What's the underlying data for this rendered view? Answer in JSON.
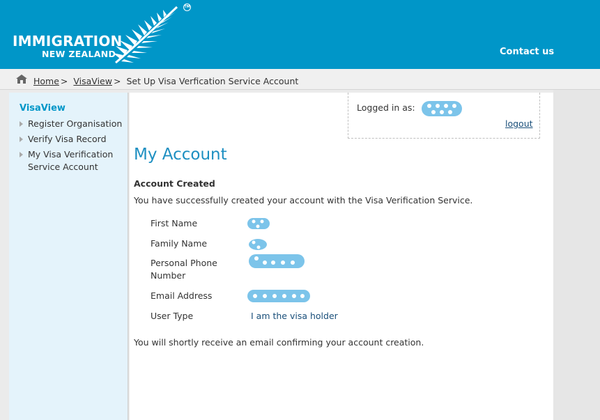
{
  "header": {
    "logo_line1": "IMMIGRATION",
    "logo_line2": "NEW ZEALAND",
    "trademark": "TM",
    "contact_label": "Contact us",
    "brand_color": "#0096c8"
  },
  "breadcrumb": {
    "home": "Home",
    "sep": ">",
    "visaview": "VisaView",
    "current": "Set Up Visa Verfication Service Account"
  },
  "sidebar": {
    "heading": "VisaView",
    "items": [
      {
        "label": "Register Organisation"
      },
      {
        "label": "Verify Visa Record"
      },
      {
        "label": "My Visa Verification Service Account"
      }
    ]
  },
  "login": {
    "label": "Logged in as:",
    "logout_label": "logout"
  },
  "main": {
    "title": "My Account",
    "section_title": "Account Created",
    "intro": "You have successfully created your account with the Visa Verification Service.",
    "fields": [
      {
        "label": "First Name"
      },
      {
        "label": "Family Name"
      },
      {
        "label": "Personal Phone Number"
      },
      {
        "label": "Email Address"
      },
      {
        "label": "User Type",
        "value": "I am the visa holder"
      }
    ],
    "footer_note": "You will shortly receive an email confirming your account creation."
  },
  "colors": {
    "redaction": "#7cc4ea",
    "sidebar_bg": "#e4f3fb",
    "title": "#1d8fc1"
  }
}
